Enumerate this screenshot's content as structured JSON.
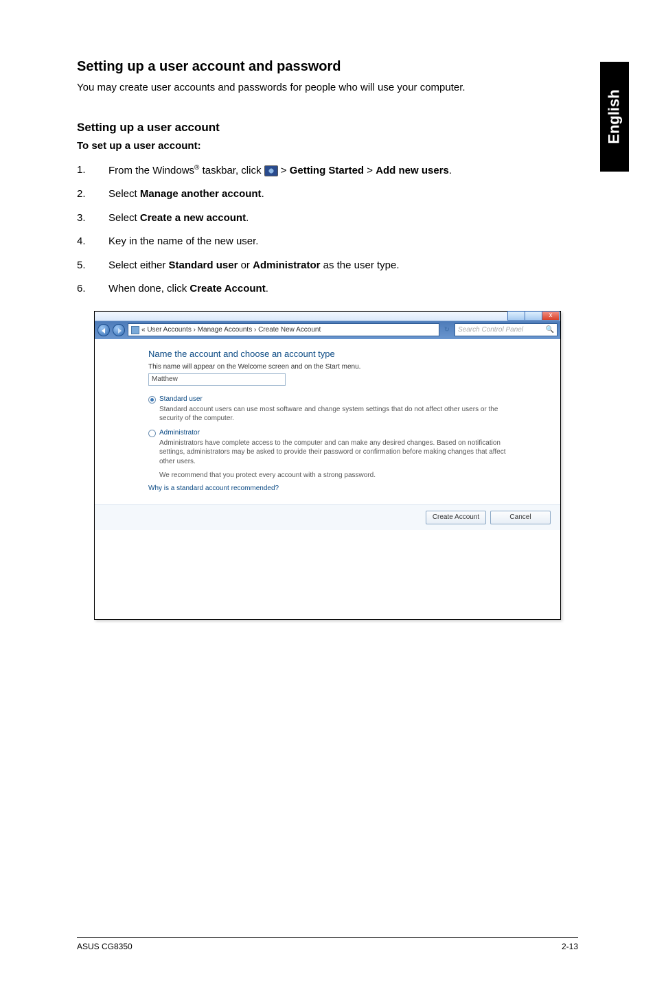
{
  "lang_tab": "English",
  "heading": "Setting up a user account and password",
  "intro": "You may create user accounts and passwords for people who will use your computer.",
  "subheading": "Setting up a user account",
  "instruction_lead": "To set up a user account:",
  "steps": [
    {
      "n": "1.",
      "pre": "From the Windows",
      "sup": "®",
      "mid": " taskbar, click ",
      "after_icon": " > ",
      "b1": "Getting Started",
      "sep": " > ",
      "b2": "Add new users",
      "end": "."
    },
    {
      "n": "2.",
      "text_pre": "Select ",
      "b": "Manage another account",
      "text_post": "."
    },
    {
      "n": "3.",
      "text_pre": "Select ",
      "b": "Create a new account",
      "text_post": "."
    },
    {
      "n": "4.",
      "plain": "Key in the name of the new user."
    },
    {
      "n": "5.",
      "text_pre": "Select either ",
      "b": "Standard user",
      "mid": " or ",
      "b2": "Administrator",
      "text_post": " as the user type."
    },
    {
      "n": "6.",
      "text_pre": "When done, click ",
      "b": "Create Account",
      "text_post": "."
    }
  ],
  "win": {
    "close_glyph": "x",
    "breadcrumb": "« User Accounts  ›  Manage Accounts  ›  Create New Account",
    "refresh": "↻",
    "search_placeholder": "Search Control Panel",
    "search_icon": "🔍",
    "title": "Name the account and choose an account type",
    "subtitle": "This name will appear on the Welcome screen and on the Start menu.",
    "input_value": "Matthew",
    "opt1_label": "Standard user",
    "opt1_desc": "Standard account users can use most software and change system settings that do not affect other users or the security of the computer.",
    "opt2_label": "Administrator",
    "opt2_desc": "Administrators have complete access to the computer and can make any desired changes. Based on notification settings, administrators may be asked to provide their password or confirmation before making changes that affect other users.",
    "note": "We recommend that you protect every account with a strong password.",
    "link": "Why is a standard account recommended?",
    "btn_create": "Create Account",
    "btn_cancel": "Cancel"
  },
  "footer": {
    "left": "ASUS CG8350",
    "right": "2-13"
  }
}
